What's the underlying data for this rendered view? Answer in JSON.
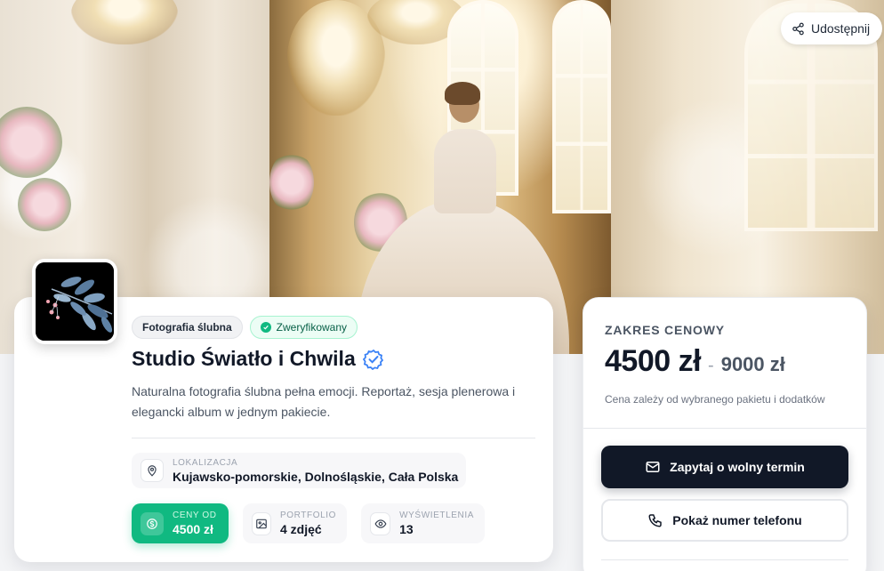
{
  "header": {
    "share_label": "Udostępnij"
  },
  "vendor": {
    "category": "Fotografia ślubna",
    "verified_label": "Zweryfikowany",
    "name": "Studio Światło i Chwila",
    "description": "Naturalna fotografia ślubna pełna emocji. Reportaż, sesja plenerowa i elegancki album w jednym pakiecie.",
    "location_label": "LOKALIZACJA",
    "location_value": "Kujawsko-pomorskie, Dolnośląskie, Cała Polska"
  },
  "stats": {
    "price": {
      "label": "CENY OD",
      "value": "4500 zł"
    },
    "portfolio": {
      "label": "PORTFOLIO",
      "value": "4 zdjęć"
    },
    "views": {
      "label": "WYŚWIETLENIA",
      "value": "13"
    }
  },
  "pricing": {
    "label": "ZAKRES CENOWY",
    "min": "4500 zł",
    "separator": "-",
    "max": "9000 zł",
    "note": "Cena zależy od wybranego pakietu i dodatków",
    "inquiry_button": "Zapytaj o wolny termin",
    "phone_button": "Pokaż numer telefonu"
  },
  "colors": {
    "accent_green": "#10b981",
    "dark_button": "#111827",
    "verified_blue": "#3b82f6"
  },
  "icons": {
    "share": "share-icon",
    "verified": "verified-check-icon",
    "location": "map-pin-icon",
    "price": "dollar-circle-icon",
    "portfolio": "image-icon",
    "views": "eye-icon",
    "mail": "mail-icon",
    "phone": "phone-icon"
  }
}
